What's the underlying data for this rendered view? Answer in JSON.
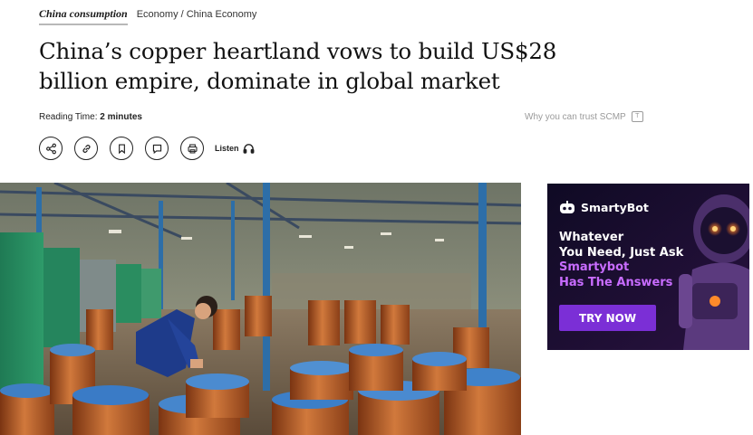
{
  "topline": {
    "topic": "China consumption",
    "breadcrumb": "Economy / China Economy"
  },
  "headline": "China’s copper heartland vows to build US$28 billion empire, dominate in global market",
  "reading": {
    "label": "Reading Time:",
    "value": "2 minutes"
  },
  "trust": {
    "label": "Why you can trust SCMP"
  },
  "share": {
    "icons": [
      "share-icon",
      "link-icon",
      "bookmark-icon",
      "comment-icon",
      "print-icon"
    ],
    "listen_label": "Listen"
  },
  "ad": {
    "brand": "SmartyBot",
    "line1": "Whatever",
    "line2": "You Need, Just Ask",
    "line3": "Smartybot",
    "line4": "Has The Answers",
    "cta": "TRY NOW",
    "colors": {
      "bg": "#120b2a",
      "accent": "#c86cff",
      "button": "#7b2fd6"
    }
  }
}
